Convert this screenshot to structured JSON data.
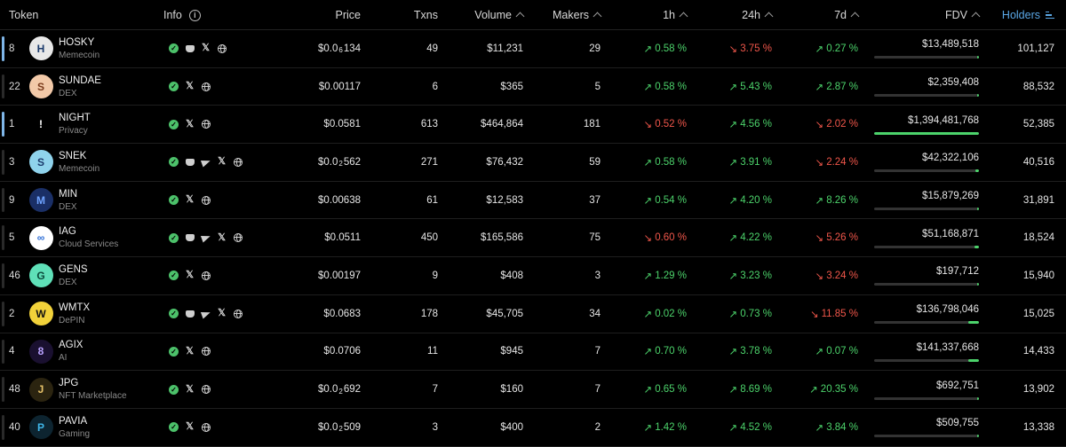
{
  "header": {
    "token": "Token",
    "info": "Info",
    "price": "Price",
    "txns": "Txns",
    "volume": "Volume",
    "makers": "Makers",
    "h1": "1h",
    "h24": "24h",
    "d7": "7d",
    "fdv": "FDV",
    "holders": "Holders"
  },
  "colors": {
    "up": "#4cd36b",
    "down": "#f0564a",
    "accent": "#5aa7e6"
  },
  "rows": [
    {
      "rank": "8",
      "highlight": true,
      "symbol": "HOSKY",
      "category": "Memecoin",
      "logo_icon": "hosky-dog-logo",
      "logo_bg": "#e8e8e8",
      "logo_fg": "#1b3a6b",
      "logo_text": "H",
      "socials": [
        "check",
        "discord",
        "x",
        "web"
      ],
      "price_pre": "$0.0",
      "price_sub": "6",
      "price_post": "134",
      "txns": "49",
      "volume": "$11,231",
      "makers": "29",
      "h1": "0.58 %",
      "h1_dir": "up",
      "h24": "3.75 %",
      "h24_dir": "dn",
      "d7": "0.27 %",
      "d7_dir": "up",
      "fdv": "$13,489,518",
      "fdv_fill": 0.01,
      "holders": "101,127"
    },
    {
      "rank": "22",
      "highlight": false,
      "symbol": "SUNDAE",
      "category": "DEX",
      "logo_icon": "sundae-logo",
      "logo_bg": "#f2c9a8",
      "logo_fg": "#7a3b1c",
      "logo_text": "S",
      "socials": [
        "check",
        "x",
        "web"
      ],
      "price_pre": "$0.00117",
      "price_sub": "",
      "price_post": "",
      "txns": "6",
      "volume": "$365",
      "makers": "5",
      "h1": "0.58 %",
      "h1_dir": "up",
      "h24": "5.43 %",
      "h24_dir": "up",
      "d7": "2.87 %",
      "d7_dir": "up",
      "fdv": "$2,359,408",
      "fdv_fill": 0.01,
      "holders": "88,532"
    },
    {
      "rank": "1",
      "highlight": true,
      "symbol": "NIGHT",
      "category": "Privacy",
      "logo_icon": "night-logo",
      "logo_bg": "#000000",
      "logo_fg": "#ffffff",
      "logo_text": "!",
      "socials": [
        "check",
        "x",
        "web"
      ],
      "price_pre": "$0.0581",
      "price_sub": "",
      "price_post": "",
      "txns": "613",
      "volume": "$464,864",
      "makers": "181",
      "h1": "0.52 %",
      "h1_dir": "dn",
      "h24": "4.56 %",
      "h24_dir": "up",
      "d7": "2.02 %",
      "d7_dir": "dn",
      "fdv": "$1,394,481,768",
      "fdv_fill": 1.0,
      "holders": "52,385"
    },
    {
      "rank": "3",
      "highlight": false,
      "symbol": "SNEK",
      "category": "Memecoin",
      "logo_icon": "snek-logo",
      "logo_bg": "#8fd3ec",
      "logo_fg": "#1b3a6b",
      "logo_text": "S",
      "socials": [
        "check",
        "discord",
        "telegram",
        "x",
        "web"
      ],
      "price_pre": "$0.0",
      "price_sub": "2",
      "price_post": "562",
      "txns": "271",
      "volume": "$76,432",
      "makers": "59",
      "h1": "0.58 %",
      "h1_dir": "up",
      "h24": "3.91 %",
      "h24_dir": "up",
      "d7": "2.24 %",
      "d7_dir": "dn",
      "fdv": "$42,322,106",
      "fdv_fill": 0.03,
      "holders": "40,516"
    },
    {
      "rank": "9",
      "highlight": false,
      "symbol": "MIN",
      "category": "DEX",
      "logo_icon": "min-cat-logo",
      "logo_bg": "#1a2f66",
      "logo_fg": "#6fa3ff",
      "logo_text": "M",
      "socials": [
        "check",
        "x",
        "web"
      ],
      "price_pre": "$0.00638",
      "price_sub": "",
      "price_post": "",
      "txns": "61",
      "volume": "$12,583",
      "makers": "37",
      "h1": "0.54 %",
      "h1_dir": "up",
      "h24": "4.20 %",
      "h24_dir": "up",
      "d7": "8.26 %",
      "d7_dir": "up",
      "fdv": "$15,879,269",
      "fdv_fill": 0.01,
      "holders": "31,891"
    },
    {
      "rank": "5",
      "highlight": false,
      "symbol": "IAG",
      "category": "Cloud Services",
      "logo_icon": "iag-logo",
      "logo_bg": "#ffffff",
      "logo_fg": "#2f6fd6",
      "logo_text": "∞",
      "socials": [
        "check",
        "discord",
        "telegram",
        "x",
        "web"
      ],
      "price_pre": "$0.0511",
      "price_sub": "",
      "price_post": "",
      "txns": "450",
      "volume": "$165,586",
      "makers": "75",
      "h1": "0.60 %",
      "h1_dir": "dn",
      "h24": "4.22 %",
      "h24_dir": "up",
      "d7": "5.26 %",
      "d7_dir": "dn",
      "fdv": "$51,168,871",
      "fdv_fill": 0.04,
      "holders": "18,524"
    },
    {
      "rank": "46",
      "highlight": false,
      "symbol": "GENS",
      "category": "DEX",
      "logo_icon": "gens-logo",
      "logo_bg": "#5fe0b8",
      "logo_fg": "#0b4a3a",
      "logo_text": "G",
      "socials": [
        "check",
        "x",
        "web"
      ],
      "price_pre": "$0.00197",
      "price_sub": "",
      "price_post": "",
      "txns": "9",
      "volume": "$408",
      "makers": "3",
      "h1": "1.29 %",
      "h1_dir": "up",
      "h24": "3.23 %",
      "h24_dir": "up",
      "d7": "3.24 %",
      "d7_dir": "dn",
      "fdv": "$197,712",
      "fdv_fill": 0.01,
      "holders": "15,940"
    },
    {
      "rank": "2",
      "highlight": false,
      "symbol": "WMTX",
      "category": "DePIN",
      "logo_icon": "wmtx-logo",
      "logo_bg": "#f2d23a",
      "logo_fg": "#111111",
      "logo_text": "W",
      "socials": [
        "check",
        "discord",
        "telegram",
        "x",
        "web"
      ],
      "price_pre": "$0.0683",
      "price_sub": "",
      "price_post": "",
      "txns": "178",
      "volume": "$45,705",
      "makers": "34",
      "h1": "0.02 %",
      "h1_dir": "up",
      "h24": "0.73 %",
      "h24_dir": "up",
      "d7": "11.85 %",
      "d7_dir": "dn",
      "fdv": "$136,798,046",
      "fdv_fill": 0.1,
      "holders": "15,025"
    },
    {
      "rank": "4",
      "highlight": false,
      "symbol": "AGIX",
      "category": "AI",
      "logo_icon": "agix-logo",
      "logo_bg": "#1a1030",
      "logo_fg": "#b9a2ff",
      "logo_text": "8",
      "socials": [
        "check",
        "x",
        "web"
      ],
      "price_pre": "$0.0706",
      "price_sub": "",
      "price_post": "",
      "txns": "11",
      "volume": "$945",
      "makers": "7",
      "h1": "0.70 %",
      "h1_dir": "up",
      "h24": "3.78 %",
      "h24_dir": "up",
      "d7": "0.07 %",
      "d7_dir": "up",
      "fdv": "$141,337,668",
      "fdv_fill": 0.1,
      "holders": "14,433"
    },
    {
      "rank": "48",
      "highlight": false,
      "symbol": "JPG",
      "category": "NFT Marketplace",
      "logo_icon": "jpg-logo",
      "logo_bg": "#2b2410",
      "logo_fg": "#e8c36a",
      "logo_text": "J",
      "socials": [
        "check",
        "x",
        "web"
      ],
      "price_pre": "$0.0",
      "price_sub": "2",
      "price_post": "692",
      "txns": "7",
      "volume": "$160",
      "makers": "7",
      "h1": "0.65 %",
      "h1_dir": "up",
      "h24": "8.69 %",
      "h24_dir": "up",
      "d7": "20.35 %",
      "d7_dir": "up",
      "fdv": "$692,751",
      "fdv_fill": 0.01,
      "holders": "13,902"
    },
    {
      "rank": "40",
      "highlight": false,
      "symbol": "PAVIA",
      "category": "Gaming",
      "logo_icon": "pavia-logo",
      "logo_bg": "#0d2430",
      "logo_fg": "#3fb6e8",
      "logo_text": "P",
      "socials": [
        "check",
        "x",
        "web"
      ],
      "price_pre": "$0.0",
      "price_sub": "2",
      "price_post": "509",
      "txns": "3",
      "volume": "$400",
      "makers": "2",
      "h1": "1.42 %",
      "h1_dir": "up",
      "h24": "4.52 %",
      "h24_dir": "up",
      "d7": "3.84 %",
      "d7_dir": "up",
      "fdv": "$509,755",
      "fdv_fill": 0.01,
      "holders": "13,338"
    }
  ]
}
